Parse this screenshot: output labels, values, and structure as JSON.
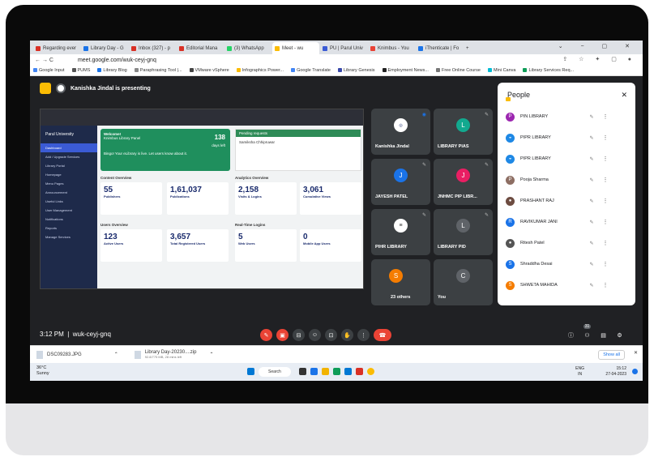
{
  "browser": {
    "tabs": [
      {
        "label": "Regarding ever",
        "color": "#d93025"
      },
      {
        "label": "Library Day - G",
        "color": "#1a73e8"
      },
      {
        "label": "Inbox (327) - p",
        "color": "#d93025"
      },
      {
        "label": "Editorial Mana",
        "color": "#d93025"
      },
      {
        "label": "(3) WhatsApp",
        "color": "#25d366"
      },
      {
        "label": "Meet - wu",
        "color": "#fbbc04"
      },
      {
        "label": "PU | Parul Univ",
        "color": "#3b5bd5"
      },
      {
        "label": "Knimbus - You",
        "color": "#e94235"
      },
      {
        "label": "iThenticate | Fo",
        "color": "#1a73e8"
      }
    ],
    "new_tab": "+",
    "url": "meet.google.com/wuk-ceyj-gnq",
    "bookmarks": [
      "Google Input",
      "PUMS",
      "Library Blog",
      "Paraphrasing Tool |...",
      "VMware vSphere",
      "Infographics Power...",
      "Google Translate",
      "Library Genesis",
      "Employment News...",
      "Free Online Course",
      "Mini Canva",
      "Library Services Req..."
    ]
  },
  "meet": {
    "presenting_text": "Kanishka Jindal is presenting",
    "shared_screen": {
      "welcome_title": "Welcome!",
      "welcome_sub": "Knimbus Library Panel",
      "days_left": "138",
      "days_left_label": "days left",
      "welcome_msg": "Bingo! Your eLibrary is live. Let users know about it.",
      "pending_title": "Pending requests",
      "pending_user": "Samiksha Chhipruwar",
      "content_overview": "Content Overview",
      "analytics_overview": "Analytics Overview",
      "users_overview": "Users Overview",
      "realtime": "Real-Time Logins",
      "sidebar": [
        "Dashboard",
        "Add / Upgrade Services",
        "Library Portal",
        "Homepage",
        "Menu Pages",
        "Announcement",
        "Useful Links",
        "User Management",
        "Notifications",
        "Reports",
        "Manage Services"
      ],
      "university": "Parul University",
      "cards": [
        {
          "value": "55",
          "label": "Publishers"
        },
        {
          "value": "1,61,037",
          "label": "Publications"
        },
        {
          "value": "2,158",
          "label": "Visits & Logins"
        },
        {
          "value": "3,061",
          "label": "Cumulative Views"
        },
        {
          "value": "123",
          "label": "Active Users"
        },
        {
          "value": "3,657",
          "label": "Total Registered Users"
        },
        {
          "value": "5",
          "label": "Web Users"
        },
        {
          "value": "0",
          "label": "Mobile App Users"
        }
      ]
    },
    "tiles": [
      {
        "name": "Kanishka Jindal",
        "initial": "",
        "color": "#ffffff"
      },
      {
        "name": "LIBRARY PIAS",
        "initial": "L",
        "color": "#12a98f"
      },
      {
        "name": "JAYESH PATEL",
        "initial": "J",
        "color": "#1a73e8"
      },
      {
        "name": "JNHMC PIP LIBR...",
        "initial": "J",
        "color": "#e91e63"
      },
      {
        "name": "PIHR LIBRARY",
        "initial": "",
        "color": "#ffffff"
      },
      {
        "name": "LIBRARY PID",
        "initial": "L",
        "color": "#5f6368"
      },
      {
        "name": "23 others",
        "initial": "S",
        "color": "#f57c00"
      },
      {
        "name": "You",
        "initial": "C",
        "color": "#5f6368"
      }
    ],
    "people_title": "People",
    "people": [
      {
        "name": "PIN LIBRARY",
        "initial": "P",
        "color": "#9c27b0"
      },
      {
        "name": "PIPR LIBRARY",
        "initial": "",
        "color": "#1e88e5"
      },
      {
        "name": "PIPR LIBRARY",
        "initial": "",
        "color": "#1e88e5"
      },
      {
        "name": "Pooja Sharma",
        "initial": "P",
        "color": "#8d6e63"
      },
      {
        "name": "PRASHANT RAJ",
        "initial": "",
        "color": "#6d4c41"
      },
      {
        "name": "RAVIKUMAR JANI",
        "initial": "R",
        "color": "#1a73e8"
      },
      {
        "name": "Ritesh Patel",
        "initial": "",
        "color": "#555555"
      },
      {
        "name": "Shraddha Desai",
        "initial": "S",
        "color": "#1a73e8"
      },
      {
        "name": "SHWETA MAHIDA",
        "initial": "S",
        "color": "#f57c00"
      }
    ],
    "time": "3:12 PM",
    "meeting_code": "wuk-ceyj-gnq",
    "participant_count": "31"
  },
  "downloads": [
    {
      "name": "DSC09283.JPG",
      "sub": ""
    },
    {
      "name": "Library Day-20230....zip",
      "sub": "92.8/775 MB, 28 mins left"
    }
  ],
  "show_all": "Show all",
  "taskbar": {
    "temp": "36°C",
    "weather": "Sunny",
    "search": "Search",
    "lang": "ENG",
    "region": "IN",
    "clock_time": "15:12",
    "clock_date": "27-04-2023"
  }
}
